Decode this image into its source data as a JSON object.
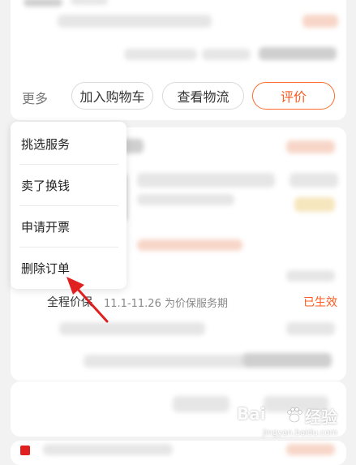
{
  "order_actions": {
    "more_label": "更多",
    "add_to_cart": "加入购物车",
    "view_logistics": "查看物流",
    "review": "评价"
  },
  "more_menu": {
    "items": [
      "挑选服务",
      "卖了换钱",
      "申请开票",
      "删除订单"
    ]
  },
  "price_protection": {
    "label": "全程价保",
    "info": "11.1-11.26 为价保服务期",
    "status": "已生效"
  },
  "watermark": {
    "brand": "Bai",
    "brand_suffix": "经验",
    "url": "jingyan.baidu.com"
  },
  "colors": {
    "accent": "#ff5a1f",
    "arrow": "#e02020"
  }
}
